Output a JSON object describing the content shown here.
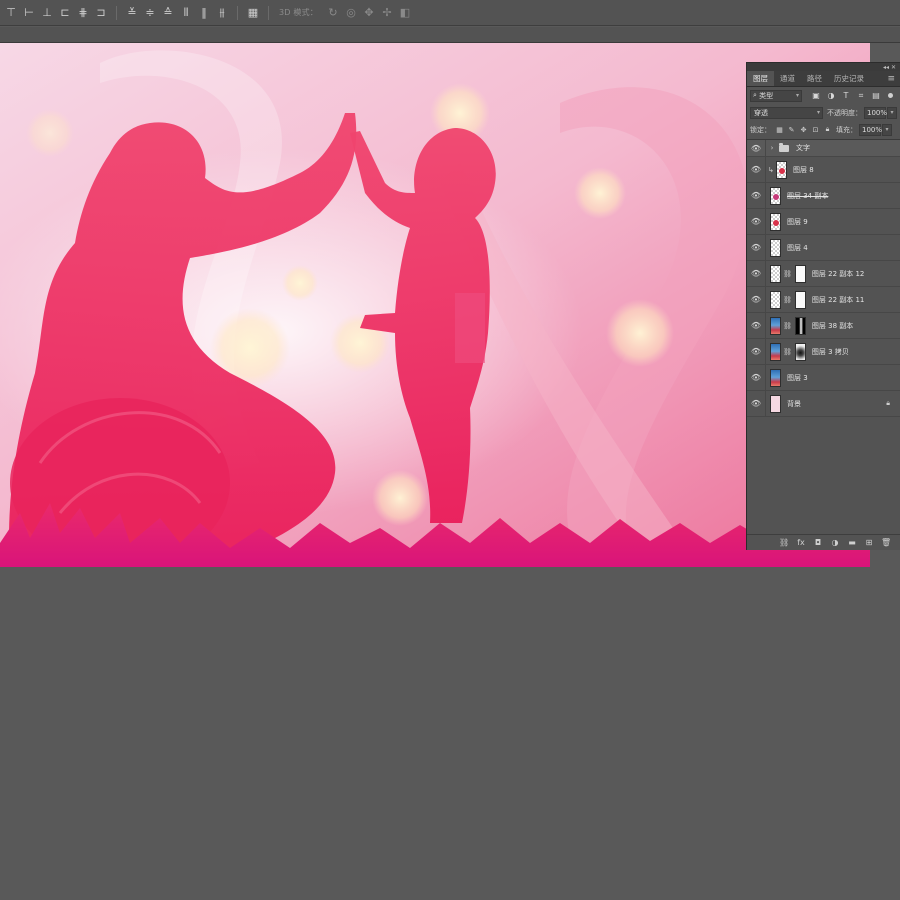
{
  "optbar": {
    "align_icons": [
      "align-top-icon",
      "align-vcenter-icon",
      "align-bottom-icon",
      "align-left-icon",
      "align-hcenter-icon",
      "align-right-icon",
      "distribute-top-icon",
      "distribute-vcenter-icon",
      "distribute-bottom-icon",
      "distribute-left-icon",
      "distribute-hcenter-icon",
      "distribute-right-icon",
      "auto-align-icon"
    ],
    "mode_3d_label": "3D 模式："
  },
  "panel": {
    "tabs": [
      "图层",
      "通道",
      "路径",
      "历史记录"
    ],
    "active_tab": "图层",
    "filter_label": "类型",
    "blend_mode": "穿透",
    "opacity_label": "不透明度：",
    "opacity_value": "100%",
    "lock_label": "锁定：",
    "fill_label": "填充：",
    "fill_value": "100%",
    "layers": [
      {
        "name": "文字",
        "kind": "group"
      },
      {
        "name": "图层 8",
        "kind": "clipped"
      },
      {
        "name": "图层 34 副本",
        "kind": "plain"
      },
      {
        "name": "图层 9",
        "kind": "plain"
      },
      {
        "name": "图层 4",
        "kind": "plain"
      },
      {
        "name": "图层 22 副本 12",
        "kind": "masked"
      },
      {
        "name": "图层 22 副本 11",
        "kind": "masked"
      },
      {
        "name": "图层 38 副本",
        "kind": "masked"
      },
      {
        "name": "图层 3 拷贝",
        "kind": "masked"
      },
      {
        "name": "图层 3",
        "kind": "plain"
      },
      {
        "name": "背景",
        "kind": "background"
      }
    ]
  },
  "colors": {
    "ui_dark": "#535353",
    "canvas_bg": "#595959",
    "accent_pink": "#e8285a"
  }
}
